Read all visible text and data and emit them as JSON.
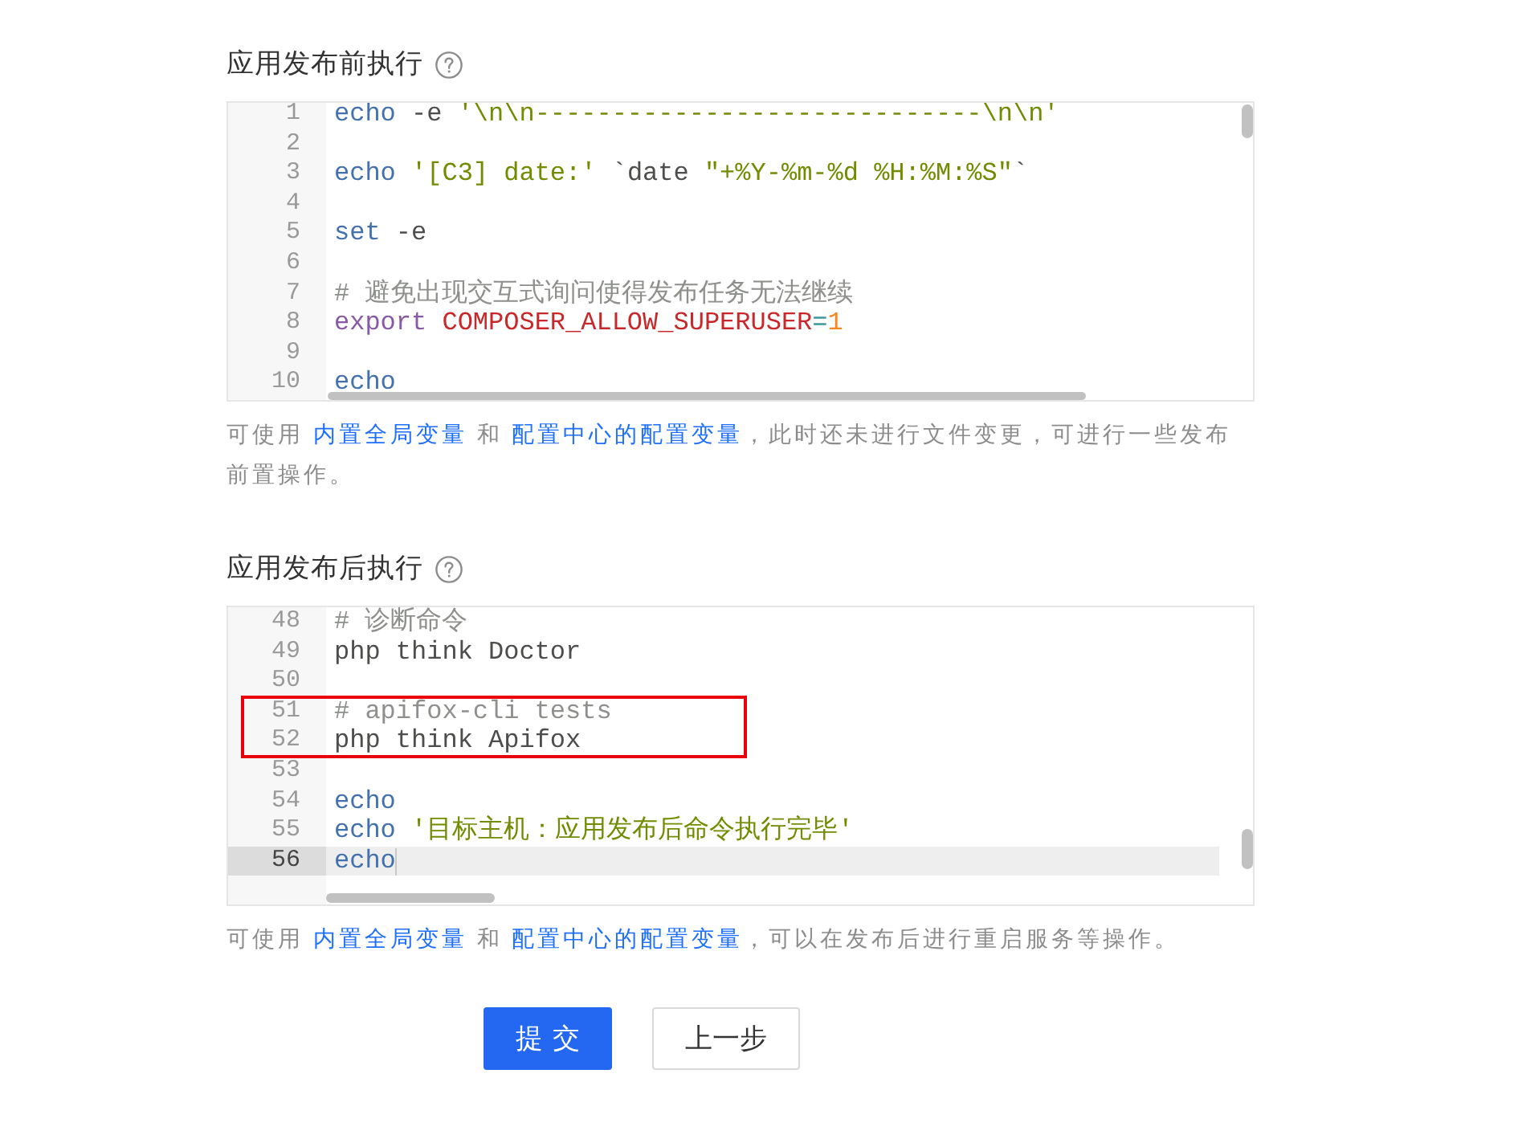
{
  "sections": [
    {
      "title": "应用发布前执行",
      "editor": {
        "lines": [
          {
            "number": "1",
            "active": false,
            "framed": false,
            "tokens": [
              {
                "kind": "builtin",
                "text": "echo"
              },
              {
                "kind": "text",
                "text": " -e "
              },
              {
                "kind": "string",
                "text": "'\\n\\n-----------------------------\\n\\n'"
              }
            ]
          },
          {
            "number": "2",
            "active": false,
            "framed": false
          },
          {
            "number": "3",
            "active": false,
            "framed": false,
            "tokens": [
              {
                "kind": "builtin",
                "text": "echo "
              },
              {
                "kind": "string",
                "text": "'[C3] date:'"
              },
              {
                "kind": "text",
                "text": " `date "
              },
              {
                "kind": "string",
                "text": "\"+%Y-%m-%d %H:%M:%S\""
              },
              {
                "kind": "text",
                "text": "`"
              }
            ]
          },
          {
            "number": "4",
            "active": false,
            "framed": false
          },
          {
            "number": "5",
            "active": false,
            "framed": false,
            "tokens": [
              {
                "kind": "builtin",
                "text": "set"
              },
              {
                "kind": "text",
                "text": " -e"
              }
            ]
          },
          {
            "number": "6",
            "active": false,
            "framed": false
          },
          {
            "number": "7",
            "active": false,
            "framed": false,
            "tokens": [
              {
                "kind": "comment",
                "text": "# 避免出现交互式询问使得发布任务无法继续"
              }
            ]
          },
          {
            "number": "8",
            "active": false,
            "framed": false,
            "tokens": [
              {
                "kind": "keyword",
                "text": "export"
              },
              {
                "kind": "variable",
                "text": " COMPOSER_ALLOW_SUPERUSER"
              },
              {
                "kind": "operator",
                "text": "="
              },
              {
                "kind": "number",
                "text": "1"
              }
            ]
          },
          {
            "number": "9",
            "active": false,
            "framed": false
          },
          {
            "number": "10",
            "active": false,
            "framed": false,
            "tokens": [
              {
                "kind": "builtin",
                "text": "echo"
              }
            ]
          }
        ]
      },
      "hint": [
        {
          "kind": "text",
          "text": "可使用 "
        },
        {
          "kind": "link",
          "text": "内置全局变量"
        },
        {
          "kind": "text",
          "text": " 和 "
        },
        {
          "kind": "link",
          "text": "配置中心的配置变量"
        },
        {
          "kind": "text",
          "text": "，此时还未进行文件变更，可进行一些发布前置操作。"
        }
      ]
    },
    {
      "title": "应用发布后执行",
      "editor": {
        "lines": [
          {
            "number": "48",
            "active": false,
            "framed": false,
            "tokens": [
              {
                "kind": "comment",
                "text": "# 诊断命令"
              }
            ]
          },
          {
            "number": "49",
            "active": false,
            "framed": false,
            "tokens": [
              {
                "kind": "text",
                "text": "php think Doctor"
              }
            ]
          },
          {
            "number": "50",
            "active": false,
            "framed": false
          },
          {
            "number": "51",
            "active": false,
            "framed": true,
            "tokens": [
              {
                "kind": "comment",
                "text": "# apifox-cli tests"
              }
            ]
          },
          {
            "number": "52",
            "active": false,
            "framed": true,
            "tokens": [
              {
                "kind": "text",
                "text": "php think Apifox"
              }
            ]
          },
          {
            "number": "53",
            "active": false,
            "framed": false
          },
          {
            "number": "54",
            "active": false,
            "framed": false,
            "tokens": [
              {
                "kind": "builtin",
                "text": "echo"
              }
            ]
          },
          {
            "number": "55",
            "active": false,
            "framed": false,
            "tokens": [
              {
                "kind": "builtin",
                "text": "echo "
              },
              {
                "kind": "string",
                "text": "'目标主机：应用发布后命令执行完毕'"
              }
            ]
          },
          {
            "number": "56",
            "active": true,
            "framed": false,
            "tokens": [
              {
                "kind": "builtin",
                "text": "echo"
              }
            ]
          }
        ]
      },
      "hint": [
        {
          "kind": "text",
          "text": "可使用 "
        },
        {
          "kind": "link",
          "text": "内置全局变量"
        },
        {
          "kind": "text",
          "text": " 和 "
        },
        {
          "kind": "link",
          "text": "配置中心的配置变量"
        },
        {
          "kind": "text",
          "text": "，可以在发布后进行重启服务等操作。"
        }
      ]
    }
  ],
  "buttons": [
    {
      "label": "提交",
      "kind": "primary"
    },
    {
      "label": "上一步",
      "kind": "default"
    }
  ]
}
